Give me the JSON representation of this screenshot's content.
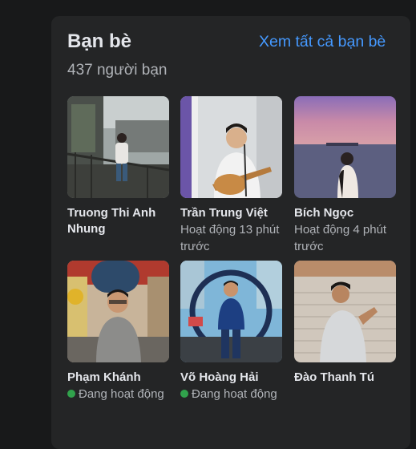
{
  "friends_section": {
    "title": "Bạn bè",
    "see_all_label": "Xem tất cả bạn bè",
    "count_text": "437 người bạn"
  },
  "friends": [
    {
      "name": "Truong Thi Anh Nhung",
      "status": "",
      "online": false
    },
    {
      "name": "Trần Trung Việt",
      "status": "Hoạt động 13 phút trước",
      "online": false
    },
    {
      "name": "Bích Ngọc",
      "status": "Hoạt động 4 phút trước",
      "online": false
    },
    {
      "name": "Phạm Khánh",
      "status": "Đang hoạt động",
      "online": true
    },
    {
      "name": "Võ Hoàng Hải",
      "status": "Đang hoạt động",
      "online": true
    },
    {
      "name": "Đào Thanh Tú",
      "status": "",
      "online": false
    }
  ],
  "colors": {
    "background": "#18191a",
    "card": "#242526",
    "text_primary": "#e4e6eb",
    "text_secondary": "#b0b3b8",
    "link": "#4599ff",
    "online_dot": "#31a24c"
  }
}
